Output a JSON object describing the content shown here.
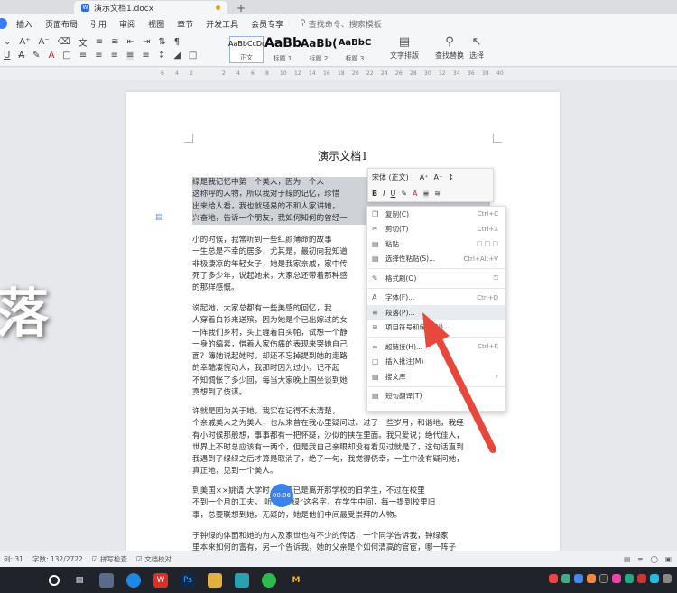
{
  "window": {
    "tab_title": "演示文档1.docx"
  },
  "menu": {
    "items": [
      "插入",
      "页面布局",
      "引用",
      "审阅",
      "视图",
      "章节",
      "开发工具",
      "会员专享"
    ],
    "search_placeholder": "查找命令、搜索模板"
  },
  "toolbar": {
    "styles": [
      {
        "preview": "AaBbCcDd",
        "label": "正文"
      },
      {
        "preview": "AaBb",
        "label": "标题 1"
      },
      {
        "preview": "AaBb(",
        "label": "标题 2"
      },
      {
        "preview": "AaBbC",
        "label": "标题 3"
      }
    ],
    "text_layout_label": "文字排版",
    "find_replace_label": "查找替换",
    "select_label": "选择"
  },
  "ruler": {
    "ticks": [
      "6",
      "4",
      "2",
      "",
      "2",
      "4",
      "6",
      "8",
      "10",
      "12",
      "14",
      "16",
      "18",
      "20",
      "22",
      "24",
      "26",
      "28",
      "30",
      "32",
      "34",
      "36",
      "38",
      "40"
    ]
  },
  "document": {
    "title": "演示文档1",
    "paragraphs": [
      "  绿是我记忆中第一个美人，因为一个人一\n这称呼的人物，所以我对于绿的记忆，珍惜\n出来给人看，我也就轻易的不和人家讲她，\n兴奋地，告诉一个朋友，我如何知何的曾经一",
      "  小的时候，我常听到一些红颜薄命的故事\n一生总是不幸的居多，尤其是，最初向我知道\n非极凄凉的年轻女子，她是我家亲戚，家中传\n死了多少年，说起她来，大家总还带着那种感\n的那样感慨。",
      "  说起她，大家总都有一些美感的回忆，我\n人穿着白衫来送殡，因为她是个已出嫁过的女\n一阵我们乡村，头上缠着白头帕，试想一个静\n一身的缟素，借着人家伤痛的表现来哭她自己\n面？簿她说起她时，却还不忘掉提到她的走路\n的幸酷凄惋动人，我那时因为过小，记不起\n不知惆怅了多少回，每当大家晚上围坐谈到她\n寞想到了伎谋。",
      "  许就是因为关于她，我实在记得不太清楚，\n个亲戚美人之为美人，也从来曾在我心里疑问过。过了一些岁月，和谐地，我经\n有小时候那般想，事事都有一把怀疑，沙似的挟在里面。我只爱说；绝代佳人，\n世界上不时总应该有一两个，但是我自己亲眼却没有看见过就是了，这句话直到\n我遇到了绿绿之后才算是取消了，绝了一句，我觉得侥幸，一生中没有疑问她，\n真正地，见到一个美人。",
      "  到美国××姚请           大学时，钟绿已是离开那学校的旧学生，不过在校里\n不到一个月的工夫，             听到“钟绿”这名字，在学生中间，每一提到校里旧\n事，总要联想到她，无疑的，她是他们中间最受崇拜的人物。",
      "  于钟绿的体面和她的为人及家世也有不少的传话，一个同学告诉我，钟绿家\n里本来如何的富有，另一个告诉我，她的父亲是个如何清高的官宦，哪一阵子\n她"
    ],
    "timer": "00:06"
  },
  "mini_toolbar": {
    "font": "宋体 (正文)",
    "size": "",
    "buttons": [
      "B",
      "I",
      "U"
    ]
  },
  "context_menu": {
    "items": [
      {
        "label": "复制(C)",
        "shortcut": "Ctrl+C"
      },
      {
        "label": "剪切(T)",
        "shortcut": "Ctrl+X"
      },
      {
        "label": "粘贴",
        "shortcut": ""
      },
      {
        "label": "选择性粘贴(S)...",
        "shortcut": "Ctrl+Alt+V"
      },
      {
        "label": "格式刷(O)",
        "shortcut": ""
      },
      {
        "label": "字体(F)...",
        "shortcut": "Ctrl+D"
      },
      {
        "label": "段落(P)...",
        "shortcut": ""
      },
      {
        "label": "项目符号和编号(N)...",
        "shortcut": ""
      },
      {
        "label": "超链接(H)...",
        "shortcut": "Ctrl+K"
      },
      {
        "label": "插入批注(M)",
        "shortcut": ""
      },
      {
        "label": "搜文库",
        "shortcut": ""
      },
      {
        "label": "短句翻译(T)",
        "shortcut": ""
      }
    ]
  },
  "overlay": {
    "big_char": "落"
  },
  "status": {
    "row": "列: 31",
    "words": "字数: 132/2722",
    "spell": "拼写检查",
    "doc_check": "文档校对"
  }
}
